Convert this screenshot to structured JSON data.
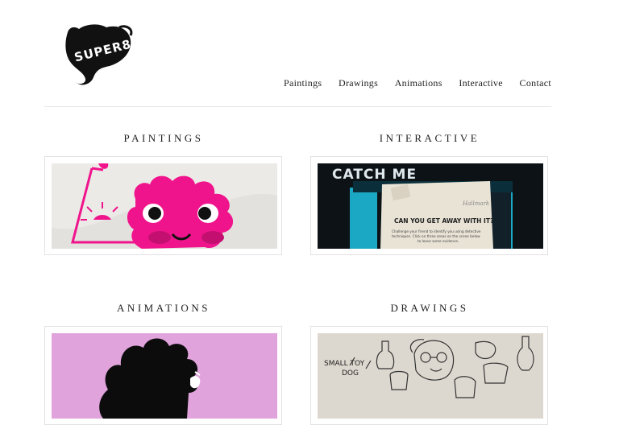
{
  "logo": {
    "text": "SUPER8"
  },
  "nav": {
    "items": [
      {
        "label": "Paintings"
      },
      {
        "label": "Drawings"
      },
      {
        "label": "Animations"
      },
      {
        "label": "Interactive"
      },
      {
        "label": "Contact"
      }
    ]
  },
  "sections": {
    "paintings": {
      "title": "PAINTINGS"
    },
    "interactive": {
      "title": "INTERACTIVE",
      "catch_me": "CATCH ME",
      "headline": "CAN YOU GET AWAY WITH IT?",
      "body_line1": "Challenge your friend to identify you using detective",
      "body_line2": "techniques. Click on three areas on the scene below",
      "body_line3": "to leave some evidence.",
      "brand": "Hallmark"
    },
    "animations": {
      "title": "ANIMATIONS"
    },
    "drawings": {
      "title": "DRAWINGS",
      "label_line1": "SMALL TOY",
      "label_line2": "DOG"
    }
  },
  "colors": {
    "pink": "#f0148c",
    "lilac": "#e0a3db",
    "teal": "#1aa8c4",
    "paper": "#e9e3d6"
  }
}
